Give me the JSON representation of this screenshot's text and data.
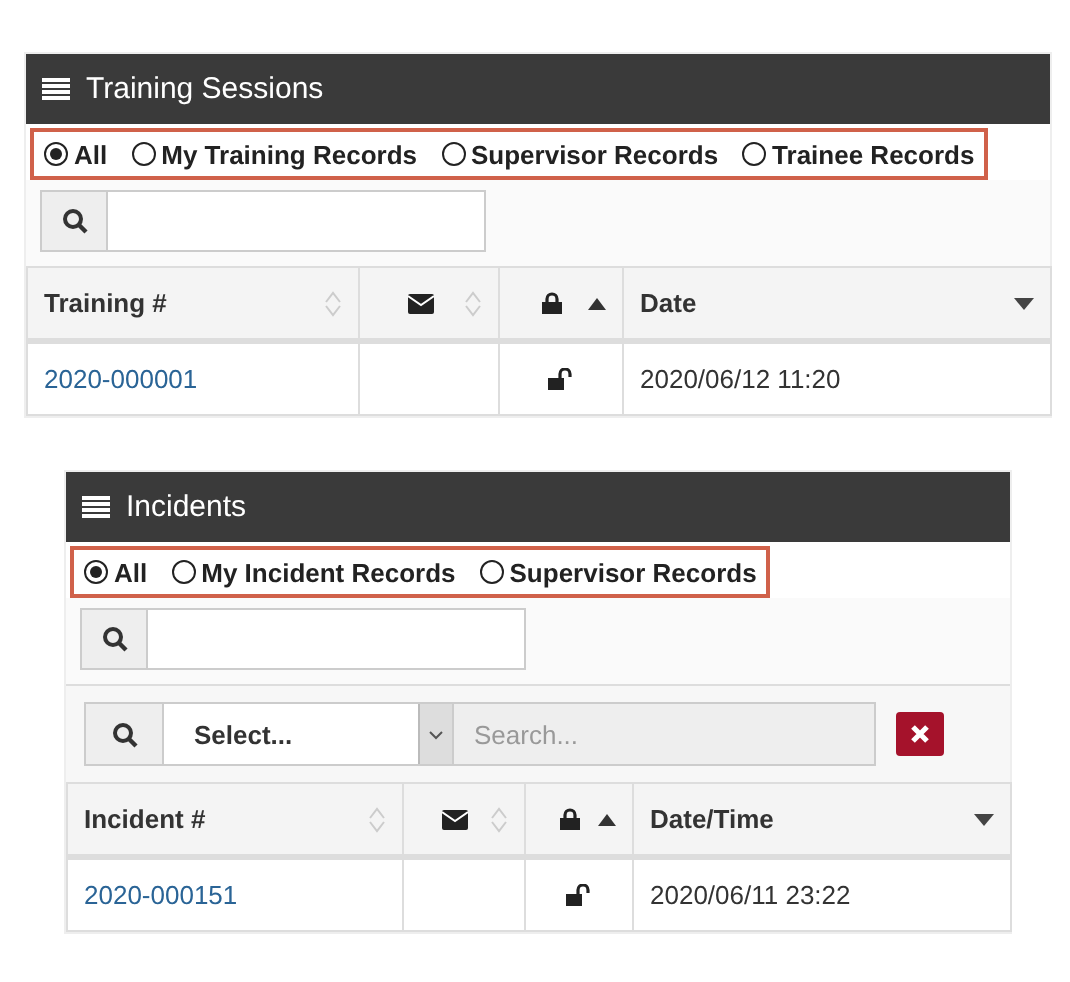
{
  "panels": [
    {
      "title": "Training Sessions",
      "filters": [
        {
          "label": "All",
          "selected": true
        },
        {
          "label": "My Training Records",
          "selected": false
        },
        {
          "label": "Supervisor Records",
          "selected": false
        },
        {
          "label": "Trainee Records",
          "selected": false
        }
      ],
      "columns": [
        {
          "kind": "text",
          "label": "Training #",
          "sorted": false
        },
        {
          "kind": "mail",
          "sorted": false
        },
        {
          "kind": "lock",
          "sorted": true,
          "ascending": true
        },
        {
          "kind": "text",
          "label": "Date",
          "sorted": true,
          "ascending": false
        }
      ],
      "rows": [
        [
          {
            "kind": "link",
            "text": "2020-000001"
          },
          {
            "kind": "empty"
          },
          {
            "kind": "unlock"
          },
          {
            "kind": "text",
            "text": "2020/06/12 11:20"
          }
        ]
      ]
    },
    {
      "title": "Incidents",
      "filters": [
        {
          "label": "All",
          "selected": true
        },
        {
          "label": "My Incident Records",
          "selected": false
        },
        {
          "label": "Supervisor Records",
          "selected": false
        }
      ],
      "filter_bar": {
        "select": "Select...",
        "placeholder": "Search..."
      },
      "columns": [
        {
          "kind": "text",
          "label": "Incident #",
          "sorted": false
        },
        {
          "kind": "mail",
          "sorted": false
        },
        {
          "kind": "lock",
          "sorted": true,
          "ascending": true
        },
        {
          "kind": "text",
          "label": "Date/Time",
          "sorted": true,
          "ascending": false
        }
      ],
      "rows": [
        [
          {
            "kind": "link",
            "text": "2020-000151"
          },
          {
            "kind": "empty"
          },
          {
            "kind": "unlock"
          },
          {
            "kind": "text",
            "text": "2020/06/11 23:22"
          }
        ]
      ]
    }
  ]
}
